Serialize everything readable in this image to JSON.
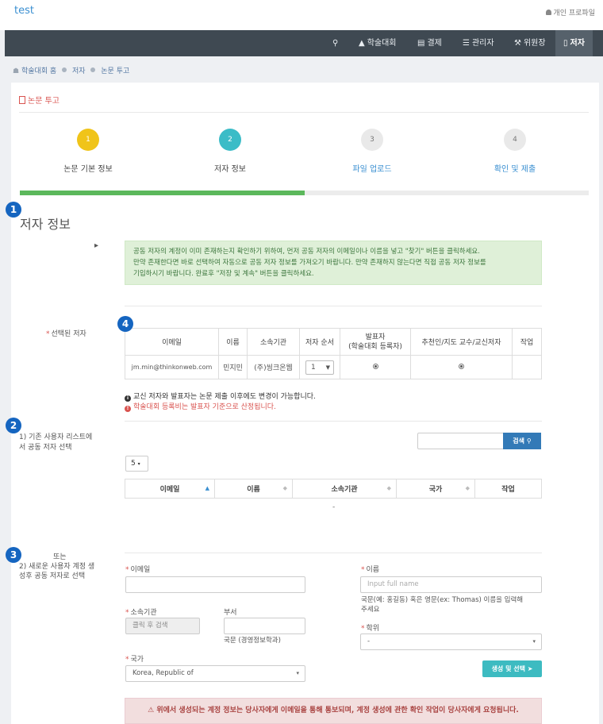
{
  "topbar": {
    "brand": "test",
    "profile": "개인 프로파일"
  },
  "nav": {
    "items": [
      "학술대회",
      "결제",
      "관리자",
      "위원장",
      "저자"
    ]
  },
  "breadcrumb": [
    "학술대회 홈",
    "저자",
    "논문 투고"
  ],
  "panel": {
    "title": "논문 투고"
  },
  "steps": [
    {
      "num": "1",
      "label": "논문 기본 정보",
      "color": "#f0c419"
    },
    {
      "num": "2",
      "label": "저자 정보",
      "color": "#3bbcc7"
    },
    {
      "num": "3",
      "label": "파일 업로드",
      "color": "#e9e9e9"
    },
    {
      "num": "4",
      "label": "확인 및 제출",
      "color": "#e9e9e9"
    }
  ],
  "progress_fraction": 0.5,
  "badges": [
    "1",
    "2",
    "3",
    "4"
  ],
  "section": {
    "title": "저자 정보",
    "info_lines": [
      "공동 저자의 계정이 이미 존재하는지 확인하기 위하여, 먼저 공동 저자의 이메일이나 이름을 넣고 \"찾기\" 버튼을 클릭하세요.",
      "만약 존재한다면 바로 선택하여 자동으로 공동 저자 정보를 가져오기 바랍니다. 만약 존재하지 않는다면 직접 공동 저자 정보를",
      "기입하시기 바랍니다. 완료후 \"저장 및 계속\" 버튼을 클릭하세요."
    ]
  },
  "selected": {
    "label": "선택된 저자",
    "headers": [
      "이메일",
      "이름",
      "소속기관",
      "저자 순서",
      "발표자\n(학술대회 등록자)",
      "추천인/지도 교수/교신저자",
      "작업"
    ],
    "row": {
      "email": "jm.min@thinkonweb.com",
      "name": "민지민",
      "org": "(주)씽크온웹",
      "order": "1"
    },
    "note_info": "교신 저자와 발표자는 논문 제출 이후에도 변경이 가능합니다.",
    "note_warn": "학술대회 등록비는 발표자 기준으로 산정됩니다."
  },
  "existing": {
    "label_line1": "1) 기존 사용자 리스트에",
    "label_line2": "서 공동 저자 선택",
    "search_button": "검색",
    "page_size": "5",
    "headers": [
      "이메일",
      "이름",
      "소속기관",
      "국가",
      "작업"
    ],
    "empty": "-"
  },
  "newuser": {
    "or_label": "또는",
    "label_line1": "2) 새로운 사용자 계정 생",
    "label_line2": "성후 공동 저자로 선택",
    "email_label": "이메일",
    "name_label": "이름",
    "name_placeholder": "Input full name",
    "name_hint1": "국문(예: 홍길동) 혹은 영문(ex: Thomas) 이름을 입력해",
    "name_hint2": "주세요",
    "org_label": "소속기관",
    "org_placeholder": "클릭 후 검색",
    "dept_label": "부서",
    "dept_hint": "국문 (경영정보학과)",
    "degree_label": "학위",
    "degree_value": "-",
    "country_label": "국가",
    "country_value": "Korea, Republic of",
    "create_button": "생성 및 선택",
    "warning": "위에서 생성되는 계정 정보는 당사자에게 이메일을 통해 통보되며, 계정 생성에 관한 확인 작업이 당사자에게 요청됩니다."
  }
}
